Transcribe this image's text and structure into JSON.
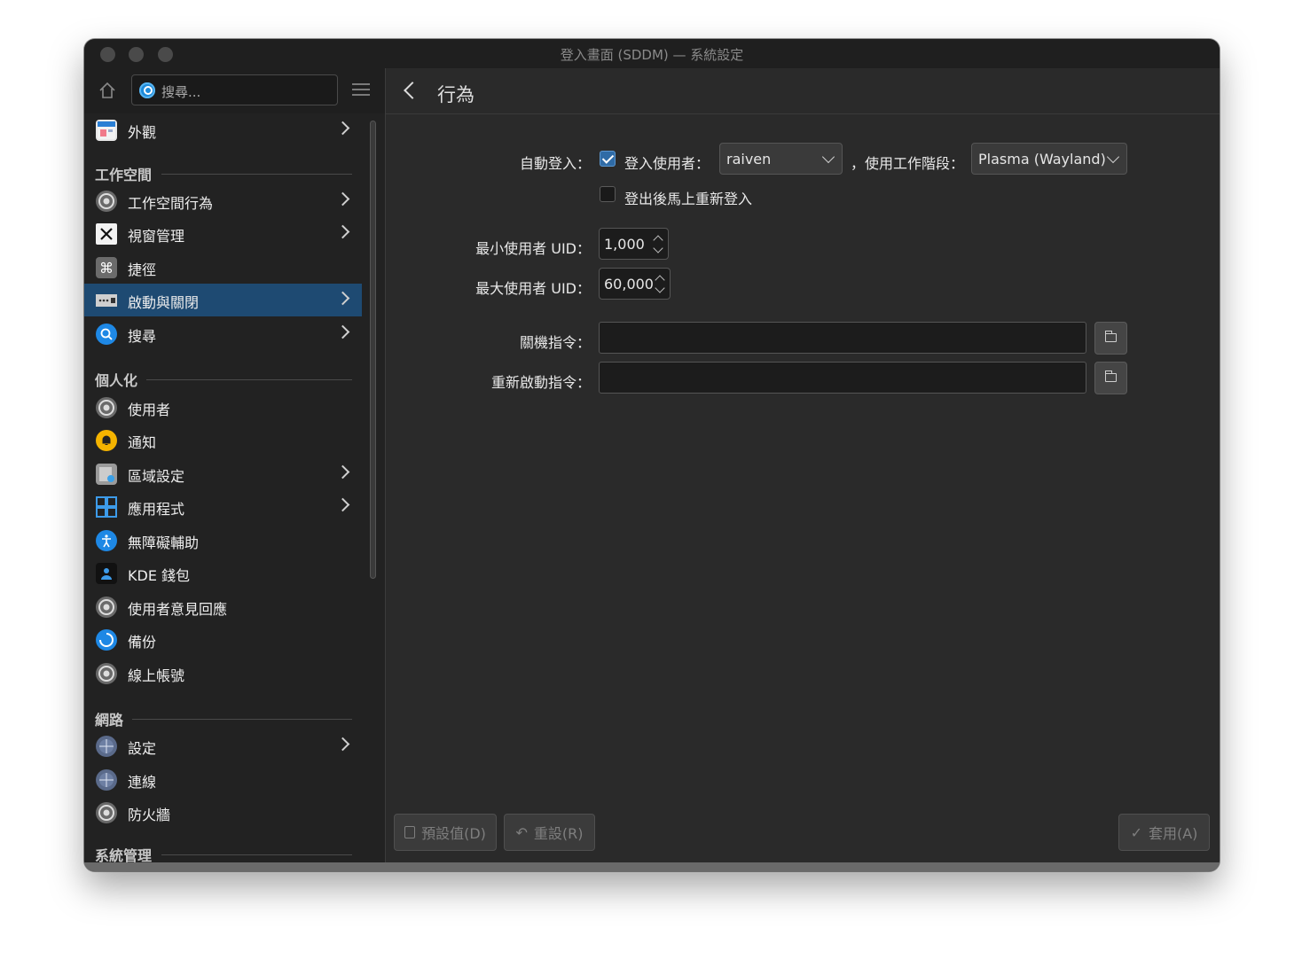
{
  "window": {
    "title": "登入畫面 (SDDM) — 系統設定"
  },
  "sidebar": {
    "search_placeholder": "搜尋...",
    "top_item": {
      "label": "外觀",
      "icon": "appearance-icon",
      "has_children": true
    },
    "sections": [
      {
        "title": "工作空間",
        "items": [
          {
            "label": "工作空間行為",
            "icon": "workspace-icon",
            "has_children": true
          },
          {
            "label": "視窗管理",
            "icon": "window-x-icon",
            "has_children": true
          },
          {
            "label": "捷徑",
            "icon": "command-key-icon",
            "has_children": false
          },
          {
            "label": "啟動與關閉",
            "icon": "startup-shutdown-icon",
            "has_children": true,
            "selected": true
          },
          {
            "label": "搜尋",
            "icon": "search-icon",
            "has_children": true
          }
        ]
      },
      {
        "title": "個人化",
        "items": [
          {
            "label": "使用者",
            "icon": "users-icon",
            "has_children": false
          },
          {
            "label": "通知",
            "icon": "bell-icon",
            "has_children": false
          },
          {
            "label": "區域設定",
            "icon": "regional-icon",
            "has_children": true
          },
          {
            "label": "應用程式",
            "icon": "applications-icon",
            "has_children": true
          },
          {
            "label": "無障礙輔助",
            "icon": "accessibility-icon",
            "has_children": false
          },
          {
            "label": "KDE 錢包",
            "icon": "wallet-icon",
            "has_children": false
          },
          {
            "label": "使用者意見回應",
            "icon": "feedback-icon",
            "has_children": false
          },
          {
            "label": "備份",
            "icon": "backup-icon",
            "has_children": false
          },
          {
            "label": "線上帳號",
            "icon": "online-accounts-icon",
            "has_children": false
          }
        ]
      },
      {
        "title": "網路",
        "items": [
          {
            "label": "設定",
            "icon": "network-settings-icon",
            "has_children": true
          },
          {
            "label": "連線",
            "icon": "connections-icon",
            "has_children": false
          },
          {
            "label": "防火牆",
            "icon": "firewall-icon",
            "has_children": false
          }
        ]
      },
      {
        "title": "系統管理",
        "items": []
      }
    ]
  },
  "main": {
    "page_title": "行為",
    "autologin_label": "自動登入：",
    "autologin_checked": true,
    "login_user_label": "登入使用者：",
    "login_user_value": "raiven",
    "session_label": "，使用工作階段：",
    "session_value": "Plasma (Wayland)",
    "relogin_label": "登出後馬上重新登入",
    "relogin_checked": false,
    "min_uid_label": "最小使用者 UID：",
    "min_uid_value": "1,000",
    "max_uid_label": "最大使用者 UID：",
    "max_uid_value": "60,000",
    "halt_label": "關機指令：",
    "halt_value": "",
    "reboot_label": "重新啟動指令：",
    "reboot_value": ""
  },
  "footer": {
    "defaults_label": "預設值(D)",
    "reset_label": "重設(R)",
    "apply_label": "套用(A)"
  },
  "colors": {
    "selection": "#1e4a72",
    "accent": "#2f6ba6"
  }
}
